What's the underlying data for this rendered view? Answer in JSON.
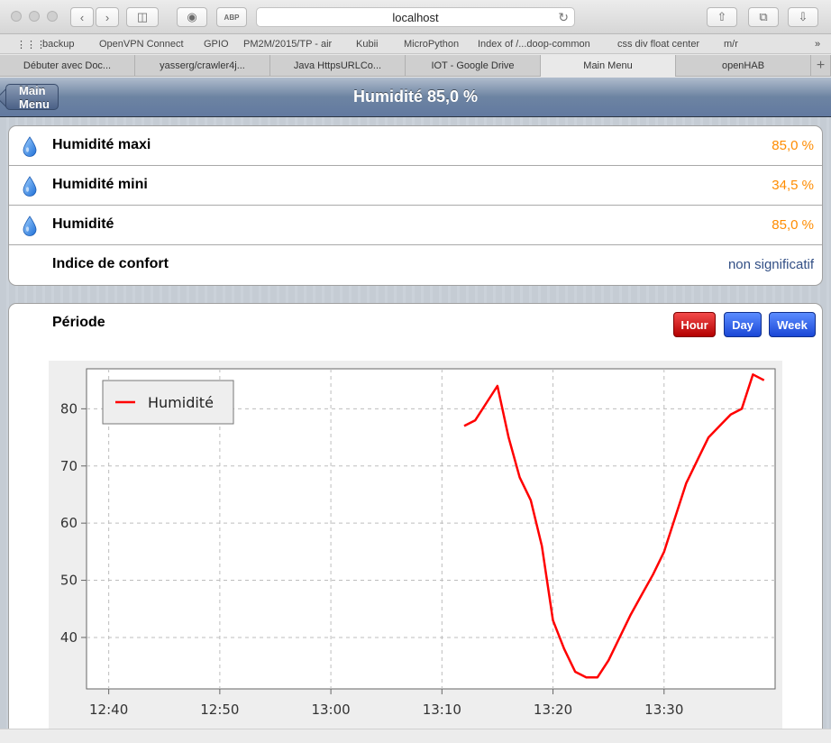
{
  "browser": {
    "address": "localhost",
    "bookmarks": [
      "backup",
      "OpenVPN Connect",
      "GPIO",
      "PM2M/2015/TP - air",
      "Kubii",
      "MicroPython",
      "Index of /...doop-common",
      "css div float center",
      "m/r"
    ],
    "tabs": [
      "Débuter avec Doc...",
      "yasserg/crawler4j...",
      "Java HttpsURLCo...",
      "IOT - Google Drive",
      "Main Menu",
      "openHAB"
    ],
    "active_tab": 4
  },
  "header": {
    "back_label": "Main Menu",
    "title": "Humidité 85,0 %"
  },
  "items": [
    {
      "label": "Humidité maxi",
      "value": "85,0 %",
      "icon": "water-drop-icon"
    },
    {
      "label": "Humidité mini",
      "value": "34,5 %",
      "icon": "water-drop-icon"
    },
    {
      "label": "Humidité",
      "value": "85,0 %",
      "icon": "water-drop-icon"
    },
    {
      "label": "Indice de confort",
      "value": "non significatif",
      "icon": ""
    }
  ],
  "period": {
    "label": "Période",
    "buttons": [
      "Hour",
      "Day",
      "Week"
    ],
    "selected": "Hour"
  },
  "colors": {
    "value_orange": "#ff8c00",
    "value_blue": "#324f85",
    "series_red": "#ff0000",
    "header_blue": "#6d84a2"
  },
  "chart_data": {
    "type": "line",
    "xlabel": "",
    "ylabel": "",
    "x_ticks": [
      "12:40",
      "12:50",
      "13:00",
      "13:10",
      "13:20",
      "13:30"
    ],
    "y_ticks": [
      40,
      50,
      60,
      70,
      80
    ],
    "xlim": [
      "12:38",
      "13:40"
    ],
    "ylim": [
      31,
      87
    ],
    "grid": true,
    "legend_position": "top-left",
    "series": [
      {
        "name": "Humidité",
        "color": "#ff0000",
        "x": [
          "13:12",
          "13:13",
          "13:14",
          "13:15",
          "13:16",
          "13:17",
          "13:18",
          "13:19",
          "13:20",
          "13:21",
          "13:22",
          "13:23",
          "13:24",
          "13:25",
          "13:26",
          "13:27",
          "13:28",
          "13:29",
          "13:30",
          "13:31",
          "13:32",
          "13:33",
          "13:34",
          "13:35",
          "13:36",
          "13:37",
          "13:38",
          "13:39"
        ],
        "values": [
          77,
          78,
          81,
          84,
          75,
          68,
          64,
          56,
          43,
          38,
          34,
          33,
          33,
          36,
          40,
          44,
          47.5,
          51,
          55,
          61,
          67,
          71,
          75,
          77,
          79,
          80,
          86,
          85
        ]
      }
    ]
  }
}
